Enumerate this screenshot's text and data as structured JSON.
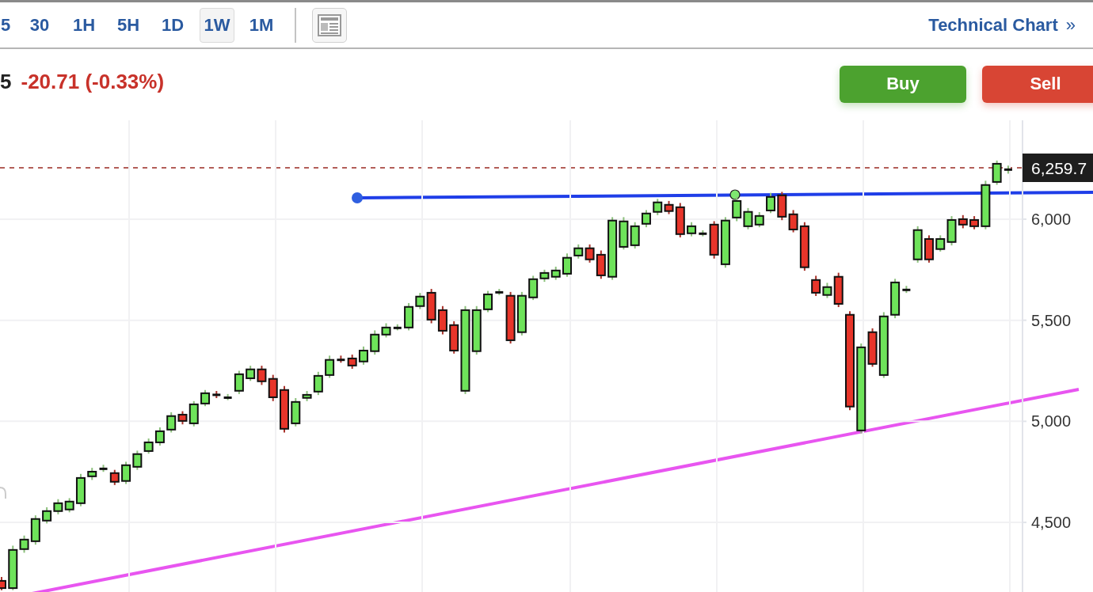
{
  "toolbar": {
    "timeframes": [
      {
        "label": "5",
        "selected": false
      },
      {
        "label": "30",
        "selected": false
      },
      {
        "label": "1H",
        "selected": false
      },
      {
        "label": "5H",
        "selected": false
      },
      {
        "label": "1D",
        "selected": false
      },
      {
        "label": "1W",
        "selected": true
      },
      {
        "label": "1M",
        "selected": false
      }
    ],
    "link": {
      "label": "Technical Chart",
      "arrow": "»"
    }
  },
  "quote": {
    "price_fragment": "5",
    "change": "-20.71 (-0.33%)"
  },
  "buttons": [
    {
      "label": "Buy",
      "kind": "buy"
    },
    {
      "label": "Sell",
      "kind": "sell"
    }
  ],
  "chart": {
    "last_price": "6,259.7",
    "chart_data": {
      "type": "candlestick",
      "ylim": [
        4148,
        6489
      ],
      "yticks": [
        {
          "value": 6000,
          "label": "6,000"
        },
        {
          "value": 5500,
          "label": "5,500"
        },
        {
          "value": 5000,
          "label": "5,000"
        },
        {
          "value": 4500,
          "label": "4,500"
        }
      ],
      "grid": true,
      "ohlc": [
        [
          4211,
          4230,
          4165,
          4175
        ],
        [
          4175,
          4385,
          4165,
          4364
        ],
        [
          4368,
          4435,
          4350,
          4415
        ],
        [
          4407,
          4535,
          4390,
          4517
        ],
        [
          4509,
          4575,
          4495,
          4556
        ],
        [
          4556,
          4615,
          4540,
          4595
        ],
        [
          4564,
          4620,
          4550,
          4603
        ],
        [
          4595,
          4740,
          4580,
          4720
        ],
        [
          4728,
          4770,
          4710,
          4751
        ],
        [
          4765,
          4785,
          4750,
          4767
        ],
        [
          4744,
          4760,
          4685,
          4701
        ],
        [
          4705,
          4800,
          4690,
          4783
        ],
        [
          4775,
          4855,
          4760,
          4838
        ],
        [
          4853,
          4915,
          4840,
          4896
        ],
        [
          4896,
          4970,
          4880,
          4951
        ],
        [
          4959,
          5045,
          4945,
          5026
        ],
        [
          5033,
          5050,
          4985,
          5002
        ],
        [
          4990,
          5100,
          4975,
          5084
        ],
        [
          5088,
          5155,
          5075,
          5139
        ],
        [
          5133,
          5150,
          5115,
          5129
        ],
        [
          5117,
          5135,
          5105,
          5119
        ],
        [
          5151,
          5250,
          5135,
          5233
        ],
        [
          5213,
          5275,
          5200,
          5257
        ],
        [
          5257,
          5275,
          5180,
          5198
        ],
        [
          5210,
          5230,
          5100,
          5119
        ],
        [
          5155,
          5175,
          4945,
          4963
        ],
        [
          4990,
          5115,
          4975,
          5096
        ],
        [
          5116,
          5150,
          5100,
          5131
        ],
        [
          5147,
          5245,
          5130,
          5225
        ],
        [
          5229,
          5325,
          5215,
          5304
        ],
        [
          5306,
          5325,
          5290,
          5302
        ],
        [
          5311,
          5330,
          5260,
          5276
        ],
        [
          5296,
          5370,
          5280,
          5350
        ],
        [
          5347,
          5450,
          5330,
          5429
        ],
        [
          5429,
          5485,
          5415,
          5464
        ],
        [
          5462,
          5480,
          5450,
          5464
        ],
        [
          5464,
          5585,
          5450,
          5566
        ],
        [
          5570,
          5635,
          5555,
          5617
        ],
        [
          5636,
          5655,
          5485,
          5503
        ],
        [
          5550,
          5570,
          5430,
          5448
        ],
        [
          5476,
          5495,
          5335,
          5350
        ],
        [
          5151,
          5570,
          5135,
          5550
        ],
        [
          5347,
          5570,
          5330,
          5550
        ],
        [
          5554,
          5645,
          5540,
          5628
        ],
        [
          5638,
          5655,
          5625,
          5640
        ],
        [
          5621,
          5640,
          5385,
          5401
        ],
        [
          5441,
          5640,
          5425,
          5621
        ],
        [
          5613,
          5720,
          5600,
          5703
        ],
        [
          5707,
          5750,
          5690,
          5734
        ],
        [
          5715,
          5765,
          5700,
          5746
        ],
        [
          5730,
          5830,
          5715,
          5809
        ],
        [
          5820,
          5875,
          5805,
          5856
        ],
        [
          5856,
          5875,
          5785,
          5801
        ],
        [
          5824,
          5845,
          5705,
          5722
        ],
        [
          5715,
          6010,
          5700,
          5993
        ],
        [
          5863,
          6010,
          5850,
          5989
        ],
        [
          5871,
          5985,
          5855,
          5965
        ],
        [
          5977,
          6045,
          5960,
          6028
        ],
        [
          6036,
          6100,
          6020,
          6083
        ],
        [
          6071,
          6090,
          6025,
          6040
        ],
        [
          6059,
          6080,
          5910,
          5926
        ],
        [
          5930,
          5985,
          5915,
          5965
        ],
        [
          5928,
          5945,
          5915,
          5930
        ],
        [
          5973,
          5990,
          5805,
          5824
        ],
        [
          5777,
          6010,
          5760,
          5993
        ],
        [
          6008,
          6110,
          5990,
          6090
        ],
        [
          5965,
          6055,
          5950,
          6036
        ],
        [
          5973,
          6035,
          5960,
          6016
        ],
        [
          6043,
          6130,
          6030,
          6110
        ],
        [
          6118,
          6135,
          5995,
          6012
        ],
        [
          6024,
          6045,
          5935,
          5949
        ],
        [
          5965,
          5985,
          5745,
          5762
        ],
        [
          5699,
          5720,
          5620,
          5636
        ],
        [
          5625,
          5685,
          5610,
          5664
        ],
        [
          5715,
          5735,
          5565,
          5581
        ],
        [
          5527,
          5545,
          5055,
          5073
        ],
        [
          4955,
          5385,
          4940,
          5366
        ],
        [
          5441,
          5460,
          5270,
          5284
        ],
        [
          5229,
          5540,
          5215,
          5519
        ],
        [
          5527,
          5705,
          5510,
          5687
        ],
        [
          5650,
          5670,
          5635,
          5652
        ],
        [
          5801,
          5965,
          5785,
          5946
        ],
        [
          5902,
          5920,
          5785,
          5801
        ],
        [
          5852,
          5920,
          5840,
          5902
        ],
        [
          5887,
          6015,
          5870,
          5996
        ],
        [
          6000,
          6020,
          5955,
          5973
        ],
        [
          5996,
          6015,
          5950,
          5965
        ],
        [
          5965,
          6190,
          5950,
          6169
        ],
        [
          6184,
          6290,
          6170,
          6274
        ],
        [
          6247,
          6265,
          6225,
          6247
        ]
      ]
    }
  }
}
